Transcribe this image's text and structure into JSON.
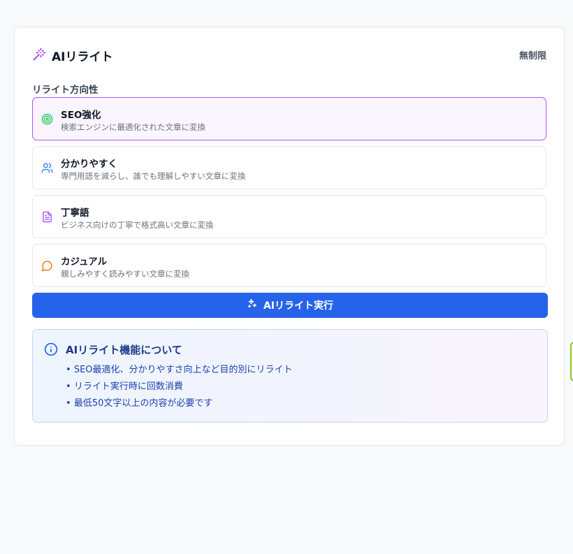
{
  "header": {
    "title": "AIリライト",
    "limit": "無制限",
    "icon": "magic-wand-icon"
  },
  "section_label": "リライト方向性",
  "options": [
    {
      "title": "SEO強化",
      "desc": "検索エンジンに最適化された文章に変換",
      "icon": "target-icon",
      "color": "#22c55e",
      "selected": true
    },
    {
      "title": "分かりやすく",
      "desc": "専門用語を減らし、誰でも理解しやすい文章に変換",
      "icon": "users-icon",
      "color": "#3b82f6",
      "selected": false
    },
    {
      "title": "丁寧語",
      "desc": "ビジネス向けの丁寧で格式高い文章に変換",
      "icon": "document-icon",
      "color": "#a855f7",
      "selected": false
    },
    {
      "title": "カジュアル",
      "desc": "親しみやすく読みやすい文章に変換",
      "icon": "chat-bubble-icon",
      "color": "#f97316",
      "selected": false
    }
  ],
  "run_button": {
    "label": "AIリライト実行",
    "icon": "sparkles-icon",
    "color": "#2563eb"
  },
  "info": {
    "title": "AIリライト機能について",
    "icon": "info-circle-icon",
    "items": [
      "SEO最適化、分かりやすさ向上など目的別にリライト",
      "リライト実行時に回数消費",
      "最低50文字以上の内容が必要です"
    ]
  }
}
